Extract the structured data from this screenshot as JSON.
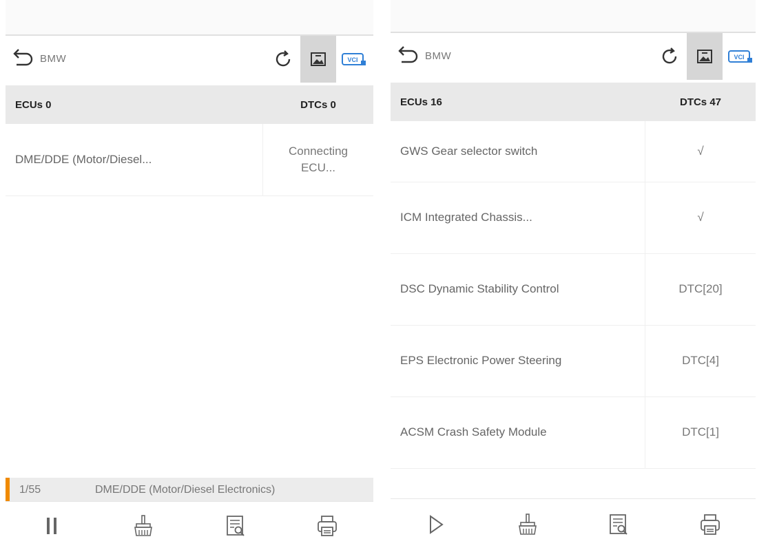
{
  "left": {
    "title": "BMW",
    "vci_label": "VCI",
    "columns": {
      "ecus": "ECUs 0",
      "dtcs": "DTCs 0"
    },
    "rows": [
      {
        "name": "DME/DDE (Motor/Diesel...",
        "value_line1": "Connecting",
        "value_line2": "ECU..."
      }
    ],
    "progress": {
      "count": "1/55",
      "text": "DME/DDE (Motor/Diesel Electronics)"
    },
    "toolbar": [
      "pause-icon",
      "clear-icon",
      "report-icon",
      "print-icon"
    ]
  },
  "right": {
    "title": "BMW",
    "vci_label": "VCI",
    "columns": {
      "ecus": "ECUs 16",
      "dtcs": "DTCs 47"
    },
    "rows": [
      {
        "name": "GWS Gear selector switch",
        "value": "√"
      },
      {
        "name": "ICM Integrated Chassis...",
        "value": "√"
      },
      {
        "name": "DSC Dynamic Stability Control",
        "value": "DTC[20]"
      },
      {
        "name": "EPS Electronic Power Steering",
        "value": "DTC[4]"
      },
      {
        "name": "ACSM Crash Safety Module",
        "value": "DTC[1]"
      }
    ],
    "toolbar": [
      "play-icon",
      "clear-icon",
      "report-icon",
      "print-icon"
    ]
  },
  "colors": {
    "accent": "#f08a00",
    "header_bg": "#e9e9e9",
    "active_btn": "#d6d6d6",
    "vci_blue": "#2f7fd6"
  }
}
